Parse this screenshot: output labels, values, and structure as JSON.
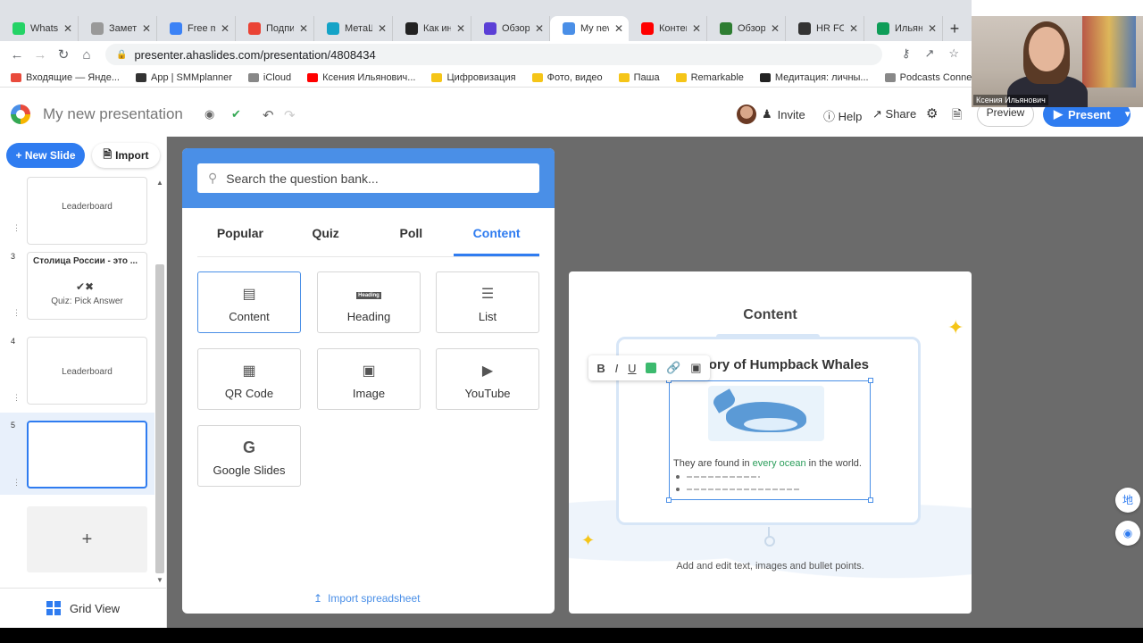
{
  "browser": {
    "tabs": [
      {
        "title": "WhatsApp",
        "color": "#25d366"
      },
      {
        "title": "Заметки",
        "color": "#999999"
      },
      {
        "title": "Free m",
        "color": "#3b82f6"
      },
      {
        "title": "Подпис",
        "color": "#ea4335"
      },
      {
        "title": "МетаШ",
        "color": "#14a3c7"
      },
      {
        "title": "Как инт",
        "color": "#222222"
      },
      {
        "title": "Обзор",
        "color": "#5b3fd6"
      },
      {
        "title": "My new",
        "color": "#4a8fe7",
        "active": true
      },
      {
        "title": "Контен",
        "color": "#ff0000"
      },
      {
        "title": "Обзор",
        "color": "#2e7d32"
      },
      {
        "title": "HR FOR",
        "color": "#333333"
      },
      {
        "title": "Ильяно",
        "color": "#0f9d58"
      }
    ],
    "url": "presenter.ahaslides.com/presentation/4808434",
    "bookmarks": [
      {
        "label": "Входящие — Янде...",
        "color": "#e94b3c"
      },
      {
        "label": "App | SMMplanner",
        "color": "#333333"
      },
      {
        "label": "iCloud",
        "color": "#888888"
      },
      {
        "label": "Ксения Ильянович...",
        "color": "#ff0000"
      },
      {
        "label": "Цифровизация",
        "color": "#f5c518"
      },
      {
        "label": "Фото, видео",
        "color": "#f5c518"
      },
      {
        "label": "Паша",
        "color": "#f5c518"
      },
      {
        "label": "Remarkable",
        "color": "#f5c518"
      },
      {
        "label": "Медитация: личны...",
        "color": "#222222"
      },
      {
        "label": "Podcasts Connect",
        "color": "#888888"
      }
    ]
  },
  "webcam": {
    "name": "Ксения Ильянович"
  },
  "header": {
    "title": "My new presentation",
    "invite": "Invite",
    "help": "Help",
    "share": "Share",
    "preview": "Preview",
    "present": "Present"
  },
  "sidebar": {
    "new_slide": "+ New Slide",
    "import": "Import",
    "slides": [
      {
        "num": "",
        "label": "Leaderboard"
      },
      {
        "num": "3",
        "title": "Столица России - это ...",
        "label": "Quiz: Pick Answer"
      },
      {
        "num": "4",
        "label": "Leaderboard"
      },
      {
        "num": "5",
        "label": ""
      }
    ],
    "add": "+",
    "grid_view": "Grid View"
  },
  "question_bank": {
    "search_placeholder": "Search the question bank...",
    "tabs": [
      "Popular",
      "Quiz",
      "Poll",
      "Content"
    ],
    "active_tab": "Content",
    "items": [
      {
        "name": "Content",
        "icon": "content-icon"
      },
      {
        "name": "Heading",
        "icon": "heading-icon"
      },
      {
        "name": "List",
        "icon": "list-icon"
      },
      {
        "name": "QR Code",
        "icon": "qr-code-icon"
      },
      {
        "name": "Image",
        "icon": "image-icon"
      },
      {
        "name": "YouTube",
        "icon": "youtube-icon"
      },
      {
        "name": "Google Slides",
        "icon": "google-icon"
      }
    ],
    "heading_icon_text": "Heading",
    "import_spreadsheet": "Import spreadsheet"
  },
  "preview": {
    "title": "Content",
    "story_title": "The Story of Humpback Whales",
    "text_before": "They are found in ",
    "text_highlight": "every ocean",
    "text_after": " in the world.",
    "caption": "Add and edit text, images and bullet points.",
    "toolbar": {
      "bold": "B",
      "italic": "I",
      "underline": "U"
    }
  }
}
